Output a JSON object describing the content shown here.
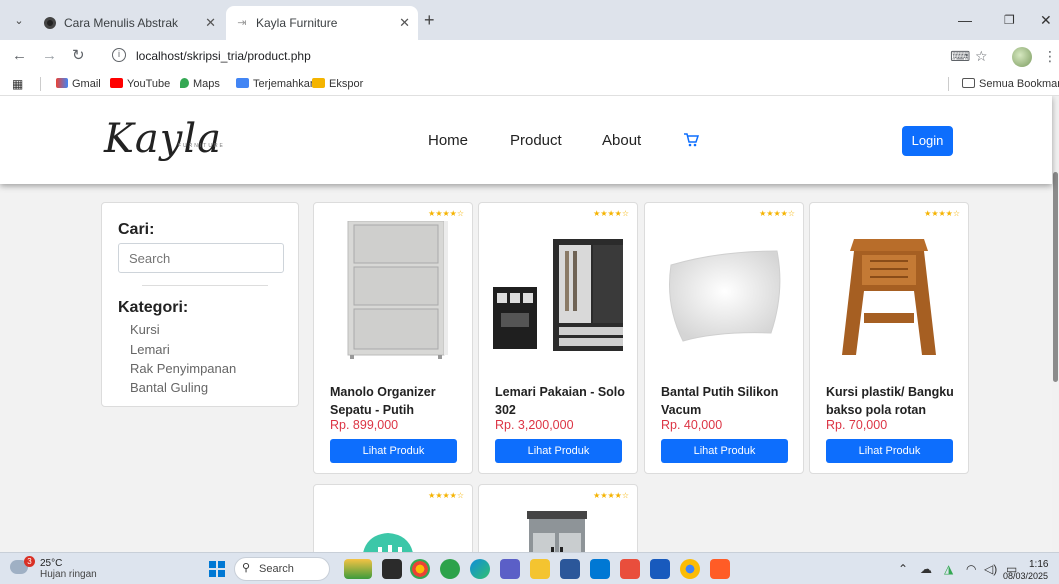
{
  "browser": {
    "tabs": [
      {
        "title": "Cara Menulis Abstrak"
      },
      {
        "title": "Kayla Furniture"
      }
    ],
    "new_tab": "+",
    "url": "localhost/skripsi_tria/product.php",
    "bookmarks": [
      "Gmail",
      "YouTube",
      "Maps",
      "Terjemahkan",
      "Ekspor"
    ],
    "all_bookmarks": "Semua Bookmark"
  },
  "site": {
    "logo": "Kayla",
    "logo_sub": "FURNITURE",
    "nav": [
      "Home",
      "Product",
      "About"
    ],
    "login": "Login"
  },
  "sidebar": {
    "search_heading": "Cari:",
    "search_placeholder": "Search",
    "category_heading": "Kategori:",
    "categories": [
      "Kursi",
      "Lemari",
      "Rak Penyimpanan",
      "Bantal Guling"
    ]
  },
  "products": [
    {
      "name": "Manolo Organizer Sepatu - Putih",
      "price": "Rp. 899,000",
      "button": "Lihat Produk",
      "rating": "★★★★☆"
    },
    {
      "name": "Lemari Pakaian - Solo 302",
      "price": "Rp. 3,200,000",
      "button": "Lihat Produk",
      "rating": "★★★★☆"
    },
    {
      "name": "Bantal Putih Silikon Vacum",
      "price": "Rp. 40,000",
      "button": "Lihat Produk",
      "rating": "★★★★☆"
    },
    {
      "name": "Kursi plastik/ Bangku bakso pola rotan",
      "price": "Rp. 70,000",
      "button": "Lihat Produk",
      "rating": "★★★★☆"
    },
    {
      "rating": "★★★★☆"
    },
    {
      "rating": "★★★★☆"
    }
  ],
  "taskbar": {
    "temperature": "25°C",
    "weather": "Hujan ringan",
    "weather_badge": "3",
    "search": "Search",
    "time": "1:16",
    "date": "08/03/2025"
  },
  "colors": {
    "primary": "#0d6efd",
    "price": "#dc3545",
    "star": "#f5b301",
    "content_bg": "#f2f2f2"
  }
}
